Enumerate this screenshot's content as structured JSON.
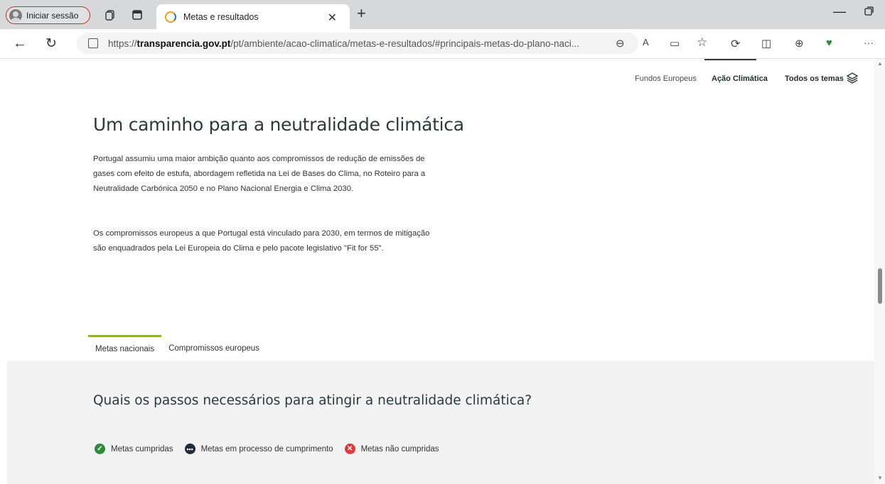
{
  "browser": {
    "profile_label": "Iniciar sessão",
    "tab_title": "Metas e resultados",
    "url_prefix": "https://",
    "url_domain": "transparencia.gov.pt",
    "url_path": "/pt/ambiente/acao-climatica/metas-e-resultados/#principais-metas-do-plano-naci..."
  },
  "header": {
    "nav": [
      "Fundos Europeus",
      "Ação Climática",
      "Todos os temas"
    ]
  },
  "main": {
    "title": "Um caminho para a neutralidade climática",
    "paragraph1": "Portugal assumiu uma maior ambição quanto aos compromissos de redução de emissões de gases com efeito de estufa, abordagem refletida na Lei de Bases do Clima, no Roteiro para a Neutralidade Carbónica 2050 e no Plano Nacional Energia e Clima 2030.",
    "paragraph2": "Os compromissos europeus a que Portugal está vinculado para 2030, em termos de mitigação são enquadrados pela Lei Europeia do Clima e pelo pacote legislativo \"Fit for 55\".",
    "tabs": [
      "Metas nacionais",
      "Compromissos europeus"
    ],
    "question": "Quais os passos necessários para atingir a neutralidade climática?",
    "legend": [
      {
        "label": "Metas cumpridas",
        "color": "#2e8b3e",
        "icon": "check-icon"
      },
      {
        "label": "Metas em processo de cumprimento",
        "color": "#1e2b3a",
        "icon": "ellipsis-icon"
      },
      {
        "label": "Metas não cumpridas",
        "color": "#e0383b",
        "icon": "x-icon"
      }
    ]
  },
  "colors": {
    "accent_tab": "#8ab52c",
    "profile_outline": "#c0392b"
  }
}
